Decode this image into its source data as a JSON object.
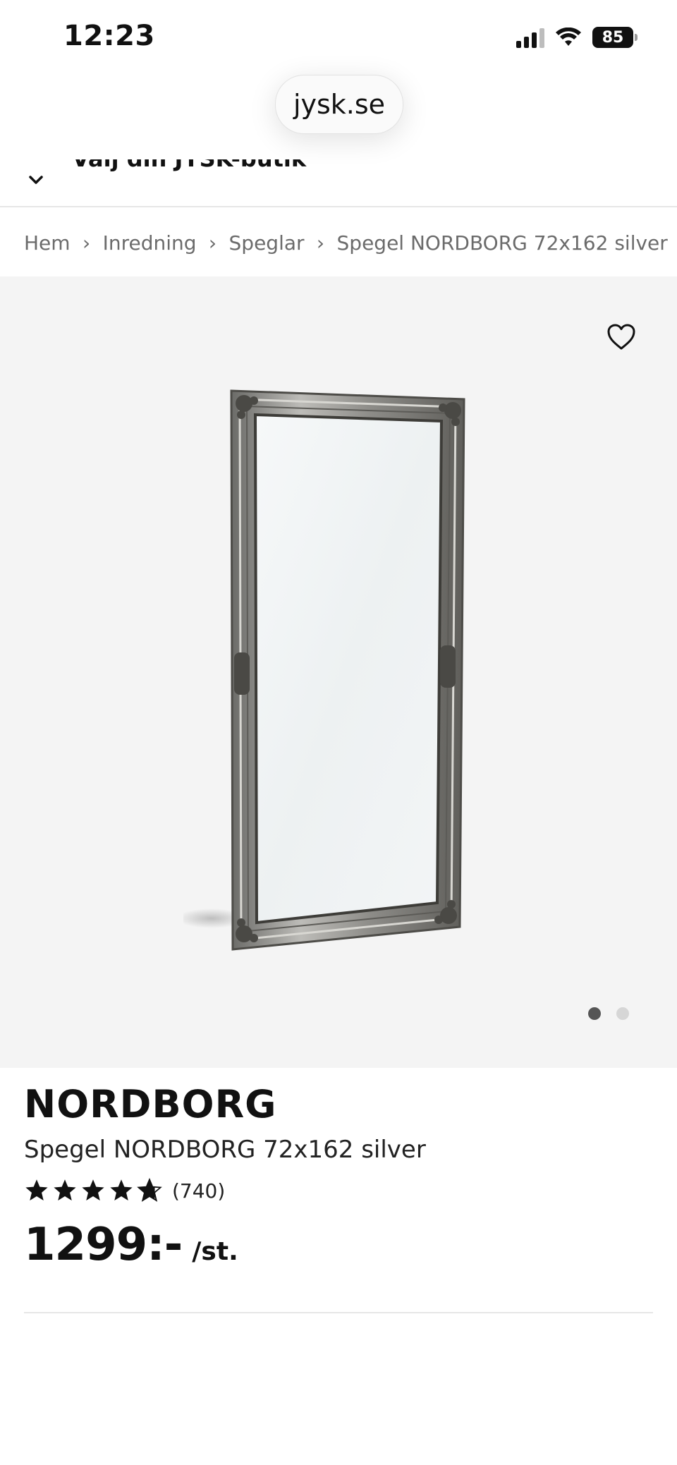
{
  "status_bar": {
    "time": "12:23",
    "battery": "85"
  },
  "browser": {
    "url": "jysk.se"
  },
  "store_selector": {
    "label": "Välj din JYSK-butik"
  },
  "breadcrumb": {
    "items": [
      "Hem",
      "Inredning",
      "Speglar",
      "Spegel NORDBORG 72x162 silver"
    ],
    "separator": "›"
  },
  "gallery": {
    "image_count": 2,
    "active_index": 0,
    "favorite_icon": "heart-outline-icon"
  },
  "product": {
    "brand": "NORDBORG",
    "name": "Spegel NORDBORG 72x162 silver",
    "rating": 4.5,
    "review_count": "(740)",
    "price": "1299:-",
    "unit": "/st."
  },
  "colors": {
    "gallery_bg": "#f4f4f4",
    "text": "#111111",
    "breadcrumb": "#6b6b6b"
  }
}
